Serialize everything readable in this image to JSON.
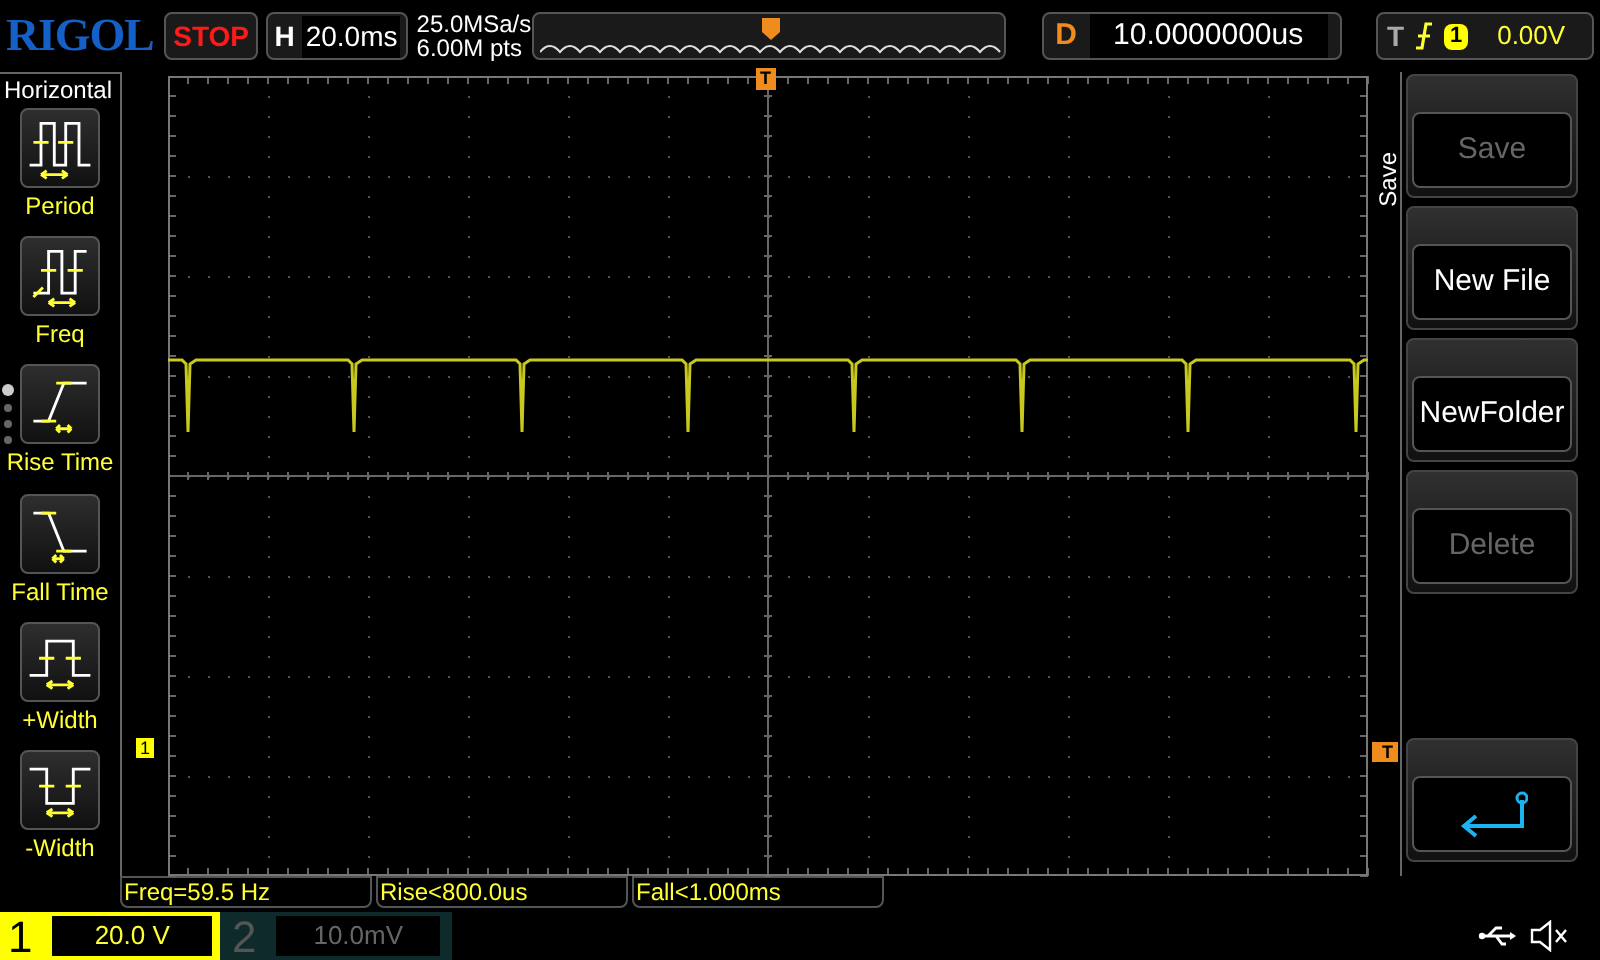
{
  "header": {
    "logo": "RIGOL",
    "run_state": "STOP",
    "timebase": {
      "label": "H",
      "value": "20.0ms"
    },
    "sample_rate": "25.0MSa/s",
    "memory_depth": "6.00M pts",
    "delay": {
      "label": "D",
      "value": "10.0000000us"
    },
    "trigger": {
      "label": "T",
      "source": "1",
      "level": "0.00V"
    }
  },
  "sidebar": {
    "title": "Horizontal",
    "items": [
      {
        "kind": "period",
        "label": "Period"
      },
      {
        "kind": "freq",
        "label": "Freq"
      },
      {
        "kind": "rise",
        "label": "Rise Time"
      },
      {
        "kind": "fall",
        "label": "Fall Time"
      },
      {
        "kind": "pwidth",
        "label": "+Width"
      },
      {
        "kind": "nwidth",
        "label": "-Width"
      }
    ],
    "pages": [
      {
        "selected": true
      },
      {
        "selected": false
      },
      {
        "selected": false
      },
      {
        "selected": false
      }
    ]
  },
  "markers": {
    "trigger_position": "T",
    "channel": "1",
    "trigger_level": "T"
  },
  "menu": {
    "title": "Save",
    "buttons": [
      {
        "kind": "text",
        "label": "Save",
        "disabled": true
      },
      {
        "kind": "text",
        "label": "New File",
        "disabled": false
      },
      {
        "kind": "text",
        "label": "NewFolder",
        "disabled": false
      },
      {
        "kind": "text",
        "label": "Delete",
        "disabled": true
      },
      {
        "kind": "back"
      }
    ]
  },
  "measurements": [
    "Freq=59.5 Hz",
    "Rise<800.0us",
    "Fall<1.000ms"
  ],
  "channels": [
    {
      "number": "1",
      "scale": "20.0 V",
      "selected": true
    },
    {
      "number": "2",
      "scale": "10.0mV",
      "selected": false
    }
  ]
}
